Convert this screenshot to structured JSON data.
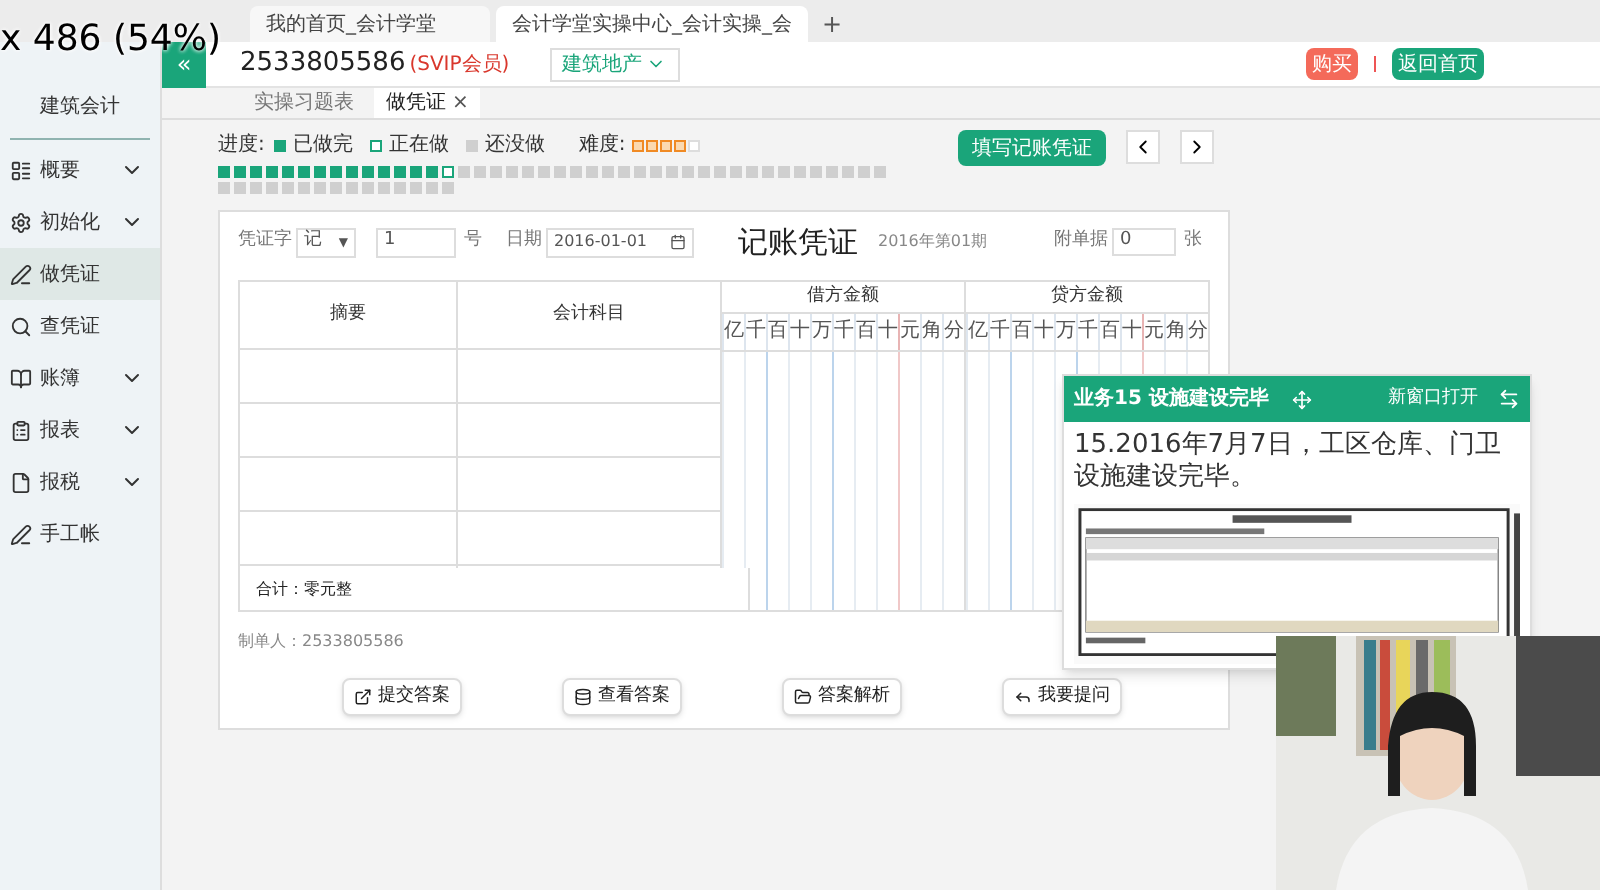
{
  "browser": {
    "tabs": [
      {
        "title": "我的首页_会计学堂",
        "selected": false
      },
      {
        "title": "会计学堂实操中心_会计实操_会",
        "selected": true
      }
    ],
    "new_tab": "+"
  },
  "size_overlay": "x 486 (54%)",
  "header": {
    "collapse": "«",
    "account": "2533805586",
    "membership": "(SVIP会员)",
    "industry": "建筑地产",
    "buy": "购买",
    "home": "返回首页"
  },
  "sidebar": {
    "title": "建筑会计",
    "items": [
      {
        "label": "概要",
        "expandable": true,
        "selected": false
      },
      {
        "label": "初始化",
        "expandable": true,
        "selected": false
      },
      {
        "label": "做凭证",
        "expandable": false,
        "selected": true
      },
      {
        "label": "查凭证",
        "expandable": false,
        "selected": false
      },
      {
        "label": "账簿",
        "expandable": true,
        "selected": false
      },
      {
        "label": "报表",
        "expandable": true,
        "selected": false
      },
      {
        "label": "报税",
        "expandable": true,
        "selected": false
      },
      {
        "label": "手工帐",
        "expandable": false,
        "selected": false
      }
    ]
  },
  "tabs": [
    {
      "label": "实操习题表",
      "selected": false
    },
    {
      "label": "做凭证",
      "selected": true,
      "close": "×"
    }
  ],
  "progress": {
    "label": "进度:",
    "legend": [
      {
        "kind": "done",
        "label": "已做完"
      },
      {
        "kind": "current",
        "label": "正在做"
      },
      {
        "kind": "todo",
        "label": "还没做"
      }
    ],
    "difficulty_label": "难度:",
    "stars": 4,
    "cells": [
      {
        "kind": "done"
      },
      {
        "kind": "done"
      },
      {
        "kind": "done"
      },
      {
        "kind": "done"
      },
      {
        "kind": "done"
      },
      {
        "kind": "done"
      },
      {
        "kind": "done"
      },
      {
        "kind": "done"
      },
      {
        "kind": "done"
      },
      {
        "kind": "done"
      },
      {
        "kind": "done"
      },
      {
        "kind": "done"
      },
      {
        "kind": "done"
      },
      {
        "kind": "done"
      },
      {
        "kind": "current"
      },
      {
        "kind": "todo"
      },
      {
        "kind": "todo"
      },
      {
        "kind": "todo"
      },
      {
        "kind": "todo"
      },
      {
        "kind": "todo"
      },
      {
        "kind": "todo"
      },
      {
        "kind": "todo"
      },
      {
        "kind": "todo"
      },
      {
        "kind": "todo"
      },
      {
        "kind": "todo"
      },
      {
        "kind": "todo"
      },
      {
        "kind": "todo"
      },
      {
        "kind": "todo"
      },
      {
        "kind": "todo"
      },
      {
        "kind": "todo"
      },
      {
        "kind": "todo"
      },
      {
        "kind": "todo"
      },
      {
        "kind": "todo"
      },
      {
        "kind": "todo"
      },
      {
        "kind": "todo"
      },
      {
        "kind": "todo"
      },
      {
        "kind": "todo"
      },
      {
        "kind": "todo"
      },
      {
        "kind": "todo"
      },
      {
        "kind": "todo"
      },
      {
        "kind": "todo"
      },
      {
        "kind": "todo"
      },
      {
        "kind": "todo"
      },
      {
        "kind": "todo"
      },
      {
        "kind": "todo"
      },
      {
        "kind": "todo"
      },
      {
        "kind": "todo"
      },
      {
        "kind": "todo"
      },
      {
        "kind": "todo"
      },
      {
        "kind": "todo"
      },
      {
        "kind": "todo"
      },
      {
        "kind": "todo"
      },
      {
        "kind": "todo"
      },
      {
        "kind": "todo"
      },
      {
        "kind": "todo"
      },
      {
        "kind": "todo"
      },
      {
        "kind": "todo"
      }
    ]
  },
  "fill_button": "填写记账凭证",
  "voucher": {
    "word_label": "凭证字",
    "word": "记",
    "word_caret": "▼",
    "number": "1",
    "number_unit": "号",
    "date_label": "日期",
    "date": "2016-01-01",
    "title": "记账凭证",
    "period": "2016年第01期",
    "attach_label": "附单据",
    "attach": "0",
    "attach_unit": "张",
    "columns": {
      "summary": "摘要",
      "account": "会计科目",
      "debit": "借方金额",
      "credit": "贷方金额"
    },
    "debit_digits": [
      "亿",
      "千",
      "百",
      "十",
      "万",
      "千",
      "百",
      "十",
      "元",
      "角",
      "分"
    ],
    "credit_digits": [
      "亿",
      "千",
      "百",
      "十",
      "万",
      "千",
      "百",
      "十",
      "元",
      "角",
      "分"
    ],
    "total": "合计：零元整",
    "maker": "制单人：2533805586",
    "actions": [
      {
        "label": "提交答案"
      },
      {
        "label": "查看答案"
      },
      {
        "label": "答案解析"
      },
      {
        "label": "我要提问"
      }
    ]
  },
  "popup": {
    "title": "业务15 设施建设完毕",
    "open_new": "新窗口打开",
    "text": "15.2016年7月7日，工区仓库、门卫设施建设完毕。"
  }
}
